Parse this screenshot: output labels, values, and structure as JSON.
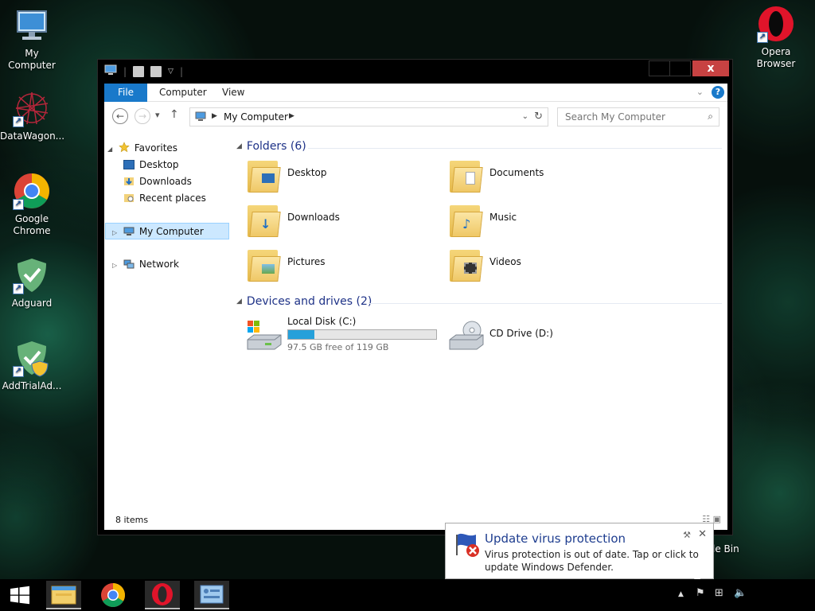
{
  "desktop": {
    "icons": [
      {
        "label": "My Computer",
        "icon": "computer-icon"
      },
      {
        "label": "DataWagon...",
        "icon": "datawagon-icon"
      },
      {
        "label": "Google Chrome",
        "icon": "chrome-icon"
      },
      {
        "label": "Adguard",
        "icon": "adguard-icon"
      },
      {
        "label": "AddTrialAd...",
        "icon": "addtrial-icon"
      },
      {
        "label": "Opera Browser",
        "icon": "opera-icon"
      }
    ],
    "recycle_bin_label": "le Bin"
  },
  "window": {
    "close_label": "x",
    "ribbon_tabs": [
      "File",
      "Computer",
      "View"
    ],
    "help_label": "?",
    "address": {
      "location": "My Computer"
    },
    "search": {
      "placeholder": "Search My Computer"
    },
    "sidebar": {
      "favorites_label": "Favorites",
      "favorites": [
        "Desktop",
        "Downloads",
        "Recent places"
      ],
      "my_computer_label": "My Computer",
      "network_label": "Network"
    },
    "folders_header": "Folders (6)",
    "folders": [
      {
        "label": "Desktop",
        "icon": "desktop-folder-icon"
      },
      {
        "label": "Documents",
        "icon": "documents-folder-icon"
      },
      {
        "label": "Downloads",
        "icon": "downloads-folder-icon"
      },
      {
        "label": "Music",
        "icon": "music-folder-icon"
      },
      {
        "label": "Pictures",
        "icon": "pictures-folder-icon"
      },
      {
        "label": "Videos",
        "icon": "videos-folder-icon"
      }
    ],
    "drives_header": "Devices and drives (2)",
    "drives": [
      {
        "label": "Local Disk (C:)",
        "free_text": "97.5 GB free of 119 GB",
        "used_fraction": 0.18
      },
      {
        "label": "CD Drive (D:)"
      }
    ],
    "status": {
      "item_count": "8 items"
    }
  },
  "notification": {
    "title": "Update virus protection",
    "body": "Virus protection is out of date. Tap or click to update Windows Defender."
  },
  "taskbar": {
    "apps": [
      "file-explorer-icon",
      "chrome-icon",
      "opera-icon",
      "control-panel-icon"
    ]
  },
  "colors": {
    "accent": "#1979ca",
    "close": "#c74242",
    "drive_bar": "#26a0da",
    "group_header": "#1e3287"
  }
}
